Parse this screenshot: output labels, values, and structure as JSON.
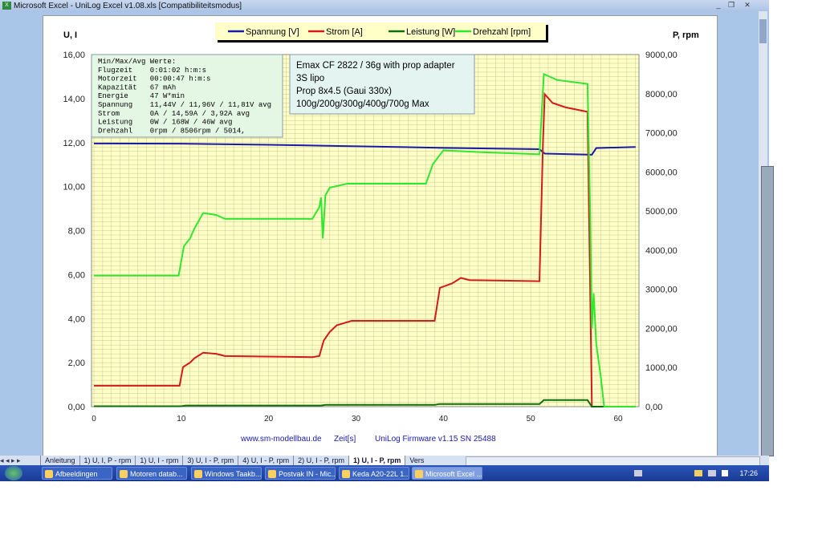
{
  "window": {
    "title": "Microsoft Excel - UniLog Excel v1.08.xls  [Compatibiliteitsmodus]"
  },
  "chart": {
    "legend": [
      "Spannung [V]",
      "Strom [A]",
      "Leistung [W]",
      "Drehzahl [rpm]"
    ],
    "left_axis_label": "U, I",
    "right_axis_label": "P, rpm",
    "xlabel": "Zeit[s]",
    "footer_left": "www.sm-modellbau.de",
    "footer_right": "UniLog Firmware v1.15 SN 25488",
    "stats": [
      "Min/Max/Avg Werte:",
      "Flugzeit    0:01:02 h:m:s",
      "Motorzeit   00:00:47 h:m:s",
      "Kapazität   67 mAh",
      "Energie     47 W*min",
      "Spannung    11,44V / 11,96V / 11,81V avg",
      "Strom       0A / 14,59A / 3,92A avg",
      "Leistung    0W / 168W / 46W avg",
      "Drehzahl    0rpm / 8506rpm / 5014,"
    ],
    "notes": [
      "Emax CF 2822 / 36g with prop adapter",
      "3S lipo",
      "Prop 8x4.5 (Gaui 330x)",
      "100g/200g/300g/400g/700g Max"
    ]
  },
  "chart_data": {
    "type": "line",
    "xlabel": "Zeit[s]",
    "ylabel": "U, I",
    "y2label": "P, rpm",
    "xlim": [
      0,
      63
    ],
    "ylim": [
      0,
      16
    ],
    "y2lim": [
      0,
      9000
    ],
    "xticks": [
      "0",
      "10",
      "20",
      "30",
      "40",
      "50",
      "60"
    ],
    "yticks": [
      "0,00",
      "2,00",
      "4,00",
      "6,00",
      "8,00",
      "10,00",
      "12,00",
      "14,00",
      "16,00"
    ],
    "y2ticks": [
      "0,00",
      "1000,00",
      "2000,00",
      "3000,00",
      "4000,00",
      "5000,00",
      "6000,00",
      "7000,00",
      "8000,00",
      "9000,00"
    ],
    "grid": true,
    "legend_position": "top",
    "series": [
      {
        "name": "Spannung [V]",
        "axis": "left",
        "color": "#1a1aa8",
        "points": [
          [
            0,
            11.96
          ],
          [
            10,
            11.95
          ],
          [
            20,
            11.9
          ],
          [
            26,
            11.86
          ],
          [
            40,
            11.76
          ],
          [
            51,
            11.7
          ],
          [
            51.6,
            11.5
          ],
          [
            57,
            11.45
          ],
          [
            57.5,
            11.75
          ],
          [
            62,
            11.8
          ]
        ]
      },
      {
        "name": "Strom [A]",
        "axis": "left",
        "color": "#d41a1a",
        "points": [
          [
            0,
            0.95
          ],
          [
            9.8,
            0.95
          ],
          [
            10.2,
            1.8
          ],
          [
            11,
            2.0
          ],
          [
            11.5,
            2.2
          ],
          [
            12.5,
            2.45
          ],
          [
            14,
            2.4
          ],
          [
            15,
            2.3
          ],
          [
            25,
            2.25
          ],
          [
            25.8,
            2.3
          ],
          [
            26.3,
            3.0
          ],
          [
            27,
            3.4
          ],
          [
            27.8,
            3.7
          ],
          [
            29.5,
            3.9
          ],
          [
            39,
            3.9
          ],
          [
            39.6,
            5.4
          ],
          [
            41,
            5.6
          ],
          [
            42,
            5.85
          ],
          [
            43,
            5.75
          ],
          [
            51,
            5.7
          ],
          [
            51.4,
            12
          ],
          [
            51.6,
            14.2
          ],
          [
            52.5,
            13.8
          ],
          [
            54,
            13.6
          ],
          [
            56.5,
            13.4
          ],
          [
            57,
            0
          ],
          [
            62,
            0
          ]
        ]
      },
      {
        "name": "Leistung [W]",
        "axis": "left",
        "color": "#0e6e0e",
        "points": [
          [
            0,
            0.02
          ],
          [
            10,
            0.02
          ],
          [
            10.5,
            0.05
          ],
          [
            26,
            0.05
          ],
          [
            26.5,
            0.08
          ],
          [
            39,
            0.08
          ],
          [
            39.5,
            0.12
          ],
          [
            51,
            0.12
          ],
          [
            51.5,
            0.3
          ],
          [
            56.5,
            0.3
          ],
          [
            57,
            0
          ],
          [
            62,
            0
          ]
        ]
      },
      {
        "name": "Drehzahl [rpm]",
        "axis": "right",
        "color": "#2ee82e",
        "points": [
          [
            0,
            3350
          ],
          [
            9.7,
            3350
          ],
          [
            10.3,
            4100
          ],
          [
            11,
            4300
          ],
          [
            11.5,
            4550
          ],
          [
            12.5,
            4950
          ],
          [
            14,
            4900
          ],
          [
            15,
            4800
          ],
          [
            25,
            4800
          ],
          [
            25.8,
            5100
          ],
          [
            26,
            5350
          ],
          [
            26.2,
            4300
          ],
          [
            26.5,
            5400
          ],
          [
            27,
            5600
          ],
          [
            29,
            5700
          ],
          [
            38,
            5700
          ],
          [
            38.8,
            6200
          ],
          [
            40,
            6550
          ],
          [
            45,
            6500
          ],
          [
            51,
            6450
          ],
          [
            51.5,
            8500
          ],
          [
            53,
            8350
          ],
          [
            56.5,
            8250
          ],
          [
            56.8,
            5000
          ],
          [
            57,
            2000
          ],
          [
            57.2,
            2900
          ],
          [
            57.5,
            1600
          ],
          [
            58,
            800
          ],
          [
            58.4,
            0
          ],
          [
            62,
            0
          ]
        ]
      }
    ]
  },
  "sheet_tabs": [
    "Anleitung",
    "1) U, I, P - rpm",
    "1) U, I - rpm",
    "3) U, I - P, rpm",
    "4) U, I - P, rpm",
    "2) U, I - P, rpm",
    "1) U, I - P, rpm",
    "Vers"
  ],
  "taskbar": {
    "items": [
      "Afbeeldingen",
      "Motoren datab...",
      "Windows Taakb...",
      "Postvak IN - Mic...",
      "Keda A20-22L 1...",
      "Microsoft Excel ..."
    ],
    "clock": "17:26"
  },
  "colors": {
    "plot_bg": "#ffffc8",
    "grid": "#c8c88c"
  }
}
